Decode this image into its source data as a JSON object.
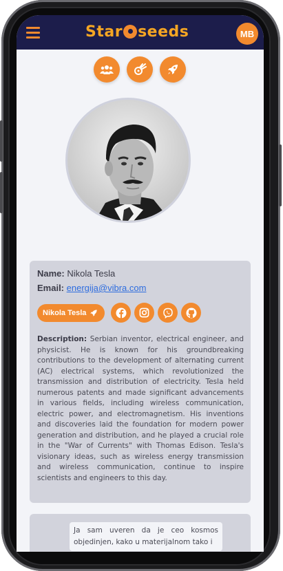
{
  "header": {
    "logo_text_left": "Star",
    "logo_text_right": "seeds",
    "avatar_initials": "MB"
  },
  "top_actions": [
    {
      "icon": "users-icon"
    },
    {
      "icon": "meteor-icon"
    },
    {
      "icon": "rocket-icon"
    }
  ],
  "profile": {
    "name_label": "Name:",
    "name_value": "Nikola Tesla",
    "email_label": "Email:",
    "email_value": "energija@vibra.com",
    "pill_label": "Nikola Tesla",
    "social_icons": [
      "facebook-icon",
      "instagram-icon",
      "viber-icon",
      "github-icon"
    ],
    "description_label": "Description:",
    "description_text": "Serbian inventor, electrical engineer, and physicist. He is known for his groundbreaking contributions to the development of alternating current (AC) electrical systems, which revolutionized the transmission and distribution of electricity. Tesla held numerous patents and made significant advancements in various fields, including wireless communication, electric power, and electromagnetism. His inventions and discoveries laid the foundation for modern power generation and distribution, and he played a crucial role in the \"War of Currents\" with Thomas Edison. Tesla's visionary ideas, such as wireless energy transmission and wireless communication, continue to inspire scientists and engineers to this day."
  },
  "quote": {
    "text": "Ja sam uveren da je ceo kosmos objedinjen, kako u materijalnom tako i"
  },
  "colors": {
    "accent": "#f28a2e",
    "header_bg": "#1c1d4b",
    "card_bg": "#d2d3dc",
    "link": "#2d6cdf"
  }
}
